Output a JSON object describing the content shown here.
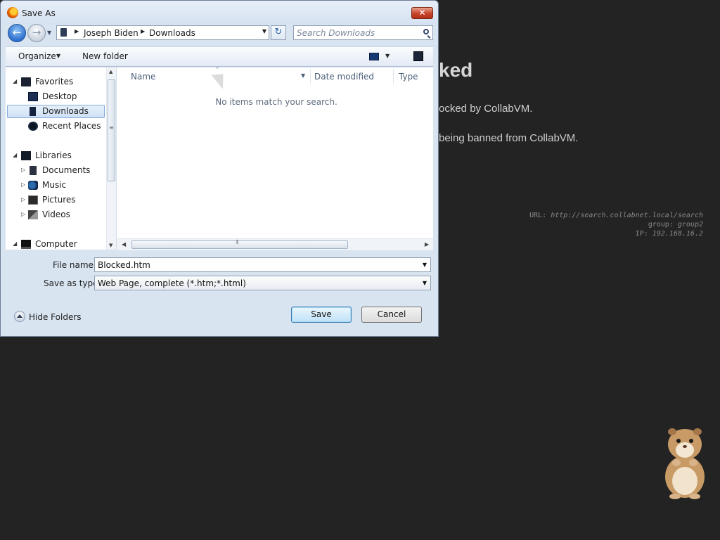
{
  "background_page": {
    "heading": "ked",
    "line1": "ocked by CollabVM.",
    "line2": "being banned from CollabVM.",
    "meta": {
      "url_label": "URL:",
      "url_value": "http://search.collabnet.local/search",
      "group_label": "group:",
      "group_value": "group2",
      "ip_label": "IP:",
      "ip_value": "192.168.16.2"
    }
  },
  "dialog": {
    "title": "Save As",
    "close_glyph": "✕",
    "nav": {
      "back_glyph": "←",
      "forward_glyph": "→",
      "breadcrumb": [
        "Joseph Biden",
        "Downloads"
      ],
      "refresh_glyph": "↻",
      "search_placeholder": "Search Downloads"
    },
    "toolbar": {
      "organize_label": "Organize",
      "new_folder_label": "New folder"
    },
    "nav_pane": {
      "items": [
        {
          "label": "Favorites",
          "icon": "favorites-star-icon",
          "expander": "◢",
          "level": 0
        },
        {
          "label": "Desktop",
          "icon": "desktop-icon",
          "expander": "",
          "level": 1
        },
        {
          "label": "Downloads",
          "icon": "downloads-icon",
          "expander": "",
          "level": 1,
          "selected": true
        },
        {
          "label": "Recent Places",
          "icon": "recent-places-icon",
          "expander": "",
          "level": 1
        },
        {
          "label": "Libraries",
          "icon": "libraries-icon",
          "expander": "◢",
          "level": 0
        },
        {
          "label": "Documents",
          "icon": "documents-icon",
          "expander": "▷",
          "level": 1
        },
        {
          "label": "Music",
          "icon": "music-icon",
          "expander": "▷",
          "level": 1
        },
        {
          "label": "Pictures",
          "icon": "pictures-icon",
          "expander": "▷",
          "level": 1
        },
        {
          "label": "Videos",
          "icon": "videos-icon",
          "expander": "▷",
          "level": 1
        },
        {
          "label": "Computer",
          "icon": "computer-icon",
          "expander": "◢",
          "level": 0
        }
      ]
    },
    "file_list": {
      "columns": [
        "Name",
        "Date modified",
        "Type"
      ],
      "empty_message": "No items match your search."
    },
    "form": {
      "file_name_label": "File name:",
      "file_name_value": "Blocked.htm",
      "save_type_label": "Save as type:",
      "save_type_value": "Web Page, complete (*.htm;*.html)"
    },
    "footer": {
      "hide_folders_label": "Hide Folders",
      "save_label": "Save",
      "cancel_label": "Cancel"
    }
  }
}
